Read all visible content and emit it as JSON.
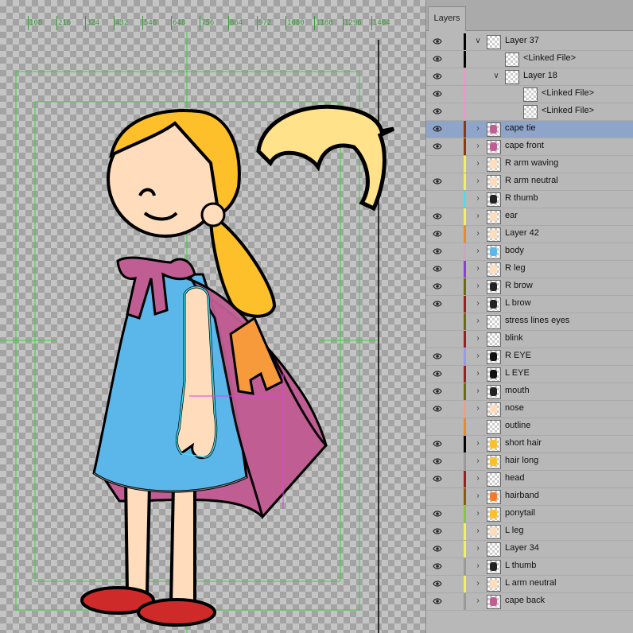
{
  "panel": {
    "tab_label": "Layers"
  },
  "ruler": {
    "labels": [
      "108",
      "216",
      "324",
      "432",
      "540",
      "648",
      "756",
      "864",
      "972",
      "1080",
      "1188",
      "1296",
      "1404"
    ]
  },
  "layers": [
    {
      "name": "Layer 37",
      "eye": true,
      "color": "#000000",
      "expander": "open",
      "indent": 0,
      "thumb": "checker"
    },
    {
      "name": "<Linked File>",
      "eye": true,
      "color": "#000000",
      "expander": "none",
      "indent": 1,
      "thumb": "checker"
    },
    {
      "name": "Layer 18",
      "eye": true,
      "color": "#e59bc7",
      "expander": "open",
      "indent": 1,
      "thumb": "checker"
    },
    {
      "name": "<Linked File>",
      "eye": true,
      "color": "#e59bc7",
      "expander": "none",
      "indent": 2,
      "thumb": "checker"
    },
    {
      "name": "<Linked File>",
      "eye": true,
      "color": "#e59bc7",
      "expander": "none",
      "indent": 2,
      "thumb": "checker"
    },
    {
      "name": "cape tie",
      "eye": true,
      "color": "#8a3a12",
      "expander": "closed",
      "indent": 0,
      "thumb": "cape-tie",
      "selected": true
    },
    {
      "name": "cape front",
      "eye": true,
      "color": "#8a3a12",
      "expander": "closed",
      "indent": 0,
      "thumb": "cape-front"
    },
    {
      "name": "R arm waving",
      "eye": false,
      "color": "#f3f05a",
      "expander": "closed",
      "indent": 0,
      "thumb": "arm"
    },
    {
      "name": "R arm neutral",
      "eye": true,
      "color": "#f3f05a",
      "expander": "closed",
      "indent": 0,
      "thumb": "arm"
    },
    {
      "name": "R thumb",
      "eye": false,
      "color": "#54d9e9",
      "expander": "closed",
      "indent": 0,
      "thumb": "thumb"
    },
    {
      "name": "ear",
      "eye": true,
      "color": "#f3f05a",
      "expander": "closed",
      "indent": 0,
      "thumb": "ear"
    },
    {
      "name": "Layer 42",
      "eye": true,
      "color": "#e98a2a",
      "expander": "closed",
      "indent": 0,
      "thumb": "arm"
    },
    {
      "name": "body",
      "eye": true,
      "color": "#c9a6c2",
      "expander": "closed",
      "indent": 0,
      "thumb": "body"
    },
    {
      "name": "R leg",
      "eye": true,
      "color": "#8b3fd6",
      "expander": "closed",
      "indent": 0,
      "thumb": "arm"
    },
    {
      "name": "R brow",
      "eye": true,
      "color": "#6b6b12",
      "expander": "closed",
      "indent": 0,
      "thumb": "brow"
    },
    {
      "name": "L brow",
      "eye": true,
      "color": "#9a1f1f",
      "expander": "closed",
      "indent": 0,
      "thumb": "brow"
    },
    {
      "name": "stress lines eyes",
      "eye": false,
      "color": "#6b6b12",
      "expander": "closed",
      "indent": 0,
      "thumb": "checker"
    },
    {
      "name": "blink",
      "eye": false,
      "color": "#9a1f1f",
      "expander": "closed",
      "indent": 0,
      "thumb": "checker"
    },
    {
      "name": "R EYE",
      "eye": true,
      "color": "#9999e8",
      "expander": "closed",
      "indent": 0,
      "thumb": "eye"
    },
    {
      "name": "L EYE",
      "eye": true,
      "color": "#9a1f1f",
      "expander": "closed",
      "indent": 0,
      "thumb": "eye"
    },
    {
      "name": "mouth",
      "eye": true,
      "color": "#6b6b12",
      "expander": "closed",
      "indent": 0,
      "thumb": "brow"
    },
    {
      "name": "nose",
      "eye": true,
      "color": "#e9a08a",
      "expander": "closed",
      "indent": 0,
      "thumb": "nose"
    },
    {
      "name": "outline",
      "eye": false,
      "color": "#e98a2a",
      "expander": "none",
      "indent": 0,
      "thumb": "checker"
    },
    {
      "name": "short hair",
      "eye": true,
      "color": "#000000",
      "expander": "closed",
      "indent": 0,
      "thumb": "hair"
    },
    {
      "name": "hair long",
      "eye": true,
      "color": "#9a9a9a",
      "expander": "closed",
      "indent": 0,
      "thumb": "hair"
    },
    {
      "name": "head",
      "eye": true,
      "color": "#9a1f1f",
      "expander": "closed",
      "indent": 0,
      "thumb": "checker"
    },
    {
      "name": "hairband",
      "eye": false,
      "color": "#8a5a12",
      "expander": "closed",
      "indent": 0,
      "thumb": "hairband"
    },
    {
      "name": "ponytail",
      "eye": true,
      "color": "#8bc53f",
      "expander": "closed",
      "indent": 0,
      "thumb": "ponytail"
    },
    {
      "name": "L leg",
      "eye": true,
      "color": "#f3f05a",
      "expander": "closed",
      "indent": 0,
      "thumb": "arm"
    },
    {
      "name": "Layer 34",
      "eye": true,
      "color": "#f3f05a",
      "expander": "closed",
      "indent": 0,
      "thumb": "checker"
    },
    {
      "name": "L thumb",
      "eye": true,
      "color": "#9a9a9a",
      "expander": "closed",
      "indent": 0,
      "thumb": "thumb"
    },
    {
      "name": "L arm neutral",
      "eye": true,
      "color": "#f3f05a",
      "expander": "closed",
      "indent": 0,
      "thumb": "arm"
    },
    {
      "name": "cape back",
      "eye": true,
      "color": "#9a9a9a",
      "expander": "closed",
      "indent": 0,
      "thumb": "cape-back"
    }
  ],
  "colors": {
    "skin": "#fedcbc",
    "hair": "#fdc02a",
    "dress": "#5bb6ea",
    "cape": "#c05e93",
    "shoes": "#cf2a2a",
    "ribbon": "#ffe28a",
    "letter": "#f79a3c",
    "selection": "#8ea4c8"
  }
}
